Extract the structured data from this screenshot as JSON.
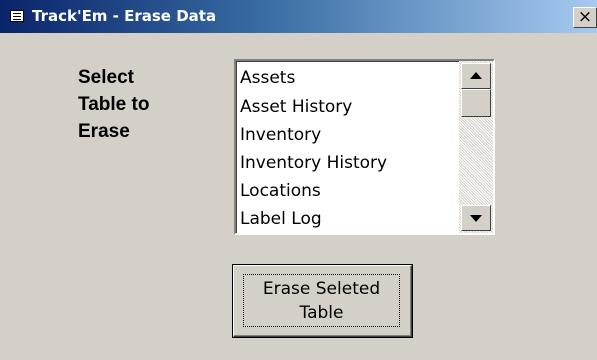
{
  "window": {
    "title": "Track'Em - Erase Data",
    "close_glyph": "×",
    "icon": "form-icon"
  },
  "form": {
    "prompt_lines": [
      "Select",
      "Table to",
      "Erase"
    ],
    "tables": [
      "Assets",
      "Asset History",
      "Inventory",
      "Inventory History",
      "Locations",
      "Label Log"
    ],
    "erase_button": [
      "Erase Seleted",
      "Table"
    ]
  },
  "colors": {
    "title_bar": "#0a246a",
    "title_bar_fade": "#a6caf0",
    "window_bg": "#d4d0c8"
  }
}
